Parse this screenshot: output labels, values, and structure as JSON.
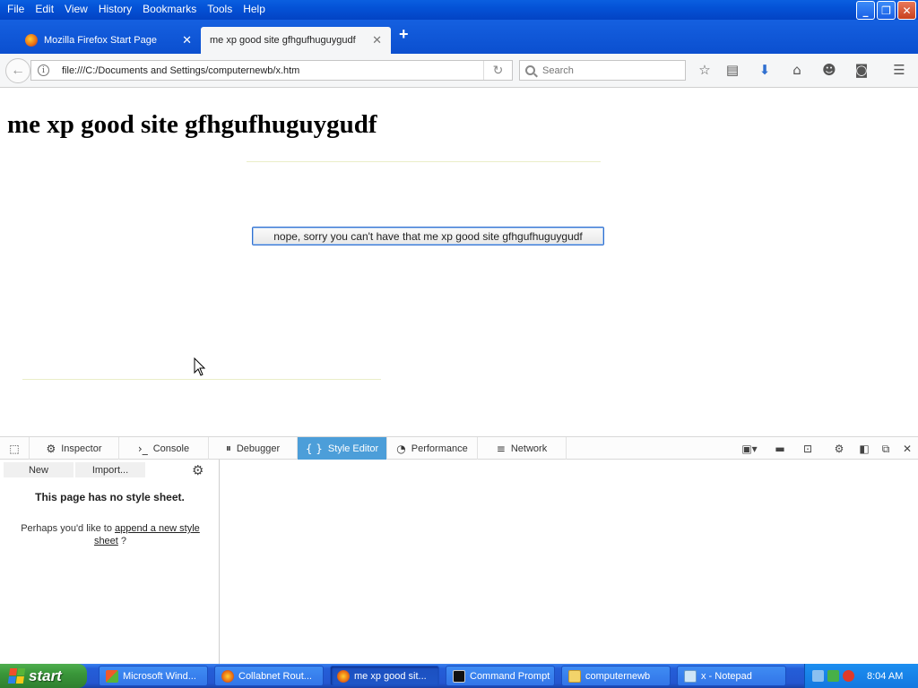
{
  "menu": [
    "File",
    "Edit",
    "View",
    "History",
    "Bookmarks",
    "Tools",
    "Help"
  ],
  "window_controls": {
    "minimize": "minimize-icon",
    "restore": "restore-icon",
    "close": "close-icon"
  },
  "tabs": [
    {
      "title": "Mozilla Firefox Start Page",
      "close": "✕"
    },
    {
      "title": "me xp good site gfhgufhuguygudf",
      "close": "✕"
    }
  ],
  "new_tab": "+",
  "navbar": {
    "url": "file:///C:/Documents and Settings/computernewb/x.htm",
    "search_placeholder": "Search",
    "icons": [
      "back-arrow-icon",
      "info-icon",
      "reload-icon",
      "search-icon",
      "bookmark-star-icon",
      "reading-list-icon",
      "download-icon",
      "home-icon",
      "smiley-icon",
      "pocket-icon",
      "hamburger-menu-icon"
    ]
  },
  "page": {
    "heading": "me xp good site gfhgufhuguygudf",
    "button_label": "nope, sorry you can't have that me xp good site gfhgufhuguygudf"
  },
  "devtools": {
    "tabs": [
      {
        "label": "Inspector",
        "icon": "inspector-icon"
      },
      {
        "label": "Console",
        "icon": "console-icon"
      },
      {
        "label": "Debugger",
        "icon": "debugger-icon"
      },
      {
        "label": "Style Editor",
        "icon": "style-editor-icon",
        "active": true
      },
      {
        "label": "Performance",
        "icon": "performance-icon"
      },
      {
        "label": "Network",
        "icon": "network-icon"
      }
    ],
    "sidebar": {
      "new_label": "New",
      "import_label": "Import...",
      "no_sheet_title": "This page has no style sheet.",
      "desc_prefix": "Perhaps you'd like to ",
      "append_link": "append a new style sheet",
      "desc_suffix": " ?"
    },
    "accent_color": "#4c9ed9"
  },
  "taskbar": {
    "start_label": "start",
    "items": [
      {
        "label": "Microsoft Wind..."
      },
      {
        "label": "Collabnet Rout..."
      },
      {
        "label": "me xp good sit...",
        "active": true
      },
      {
        "label": "Command Prompt"
      },
      {
        "label": "computernewb"
      },
      {
        "label": "x - Notepad"
      }
    ],
    "clock": "8:04 AM"
  }
}
